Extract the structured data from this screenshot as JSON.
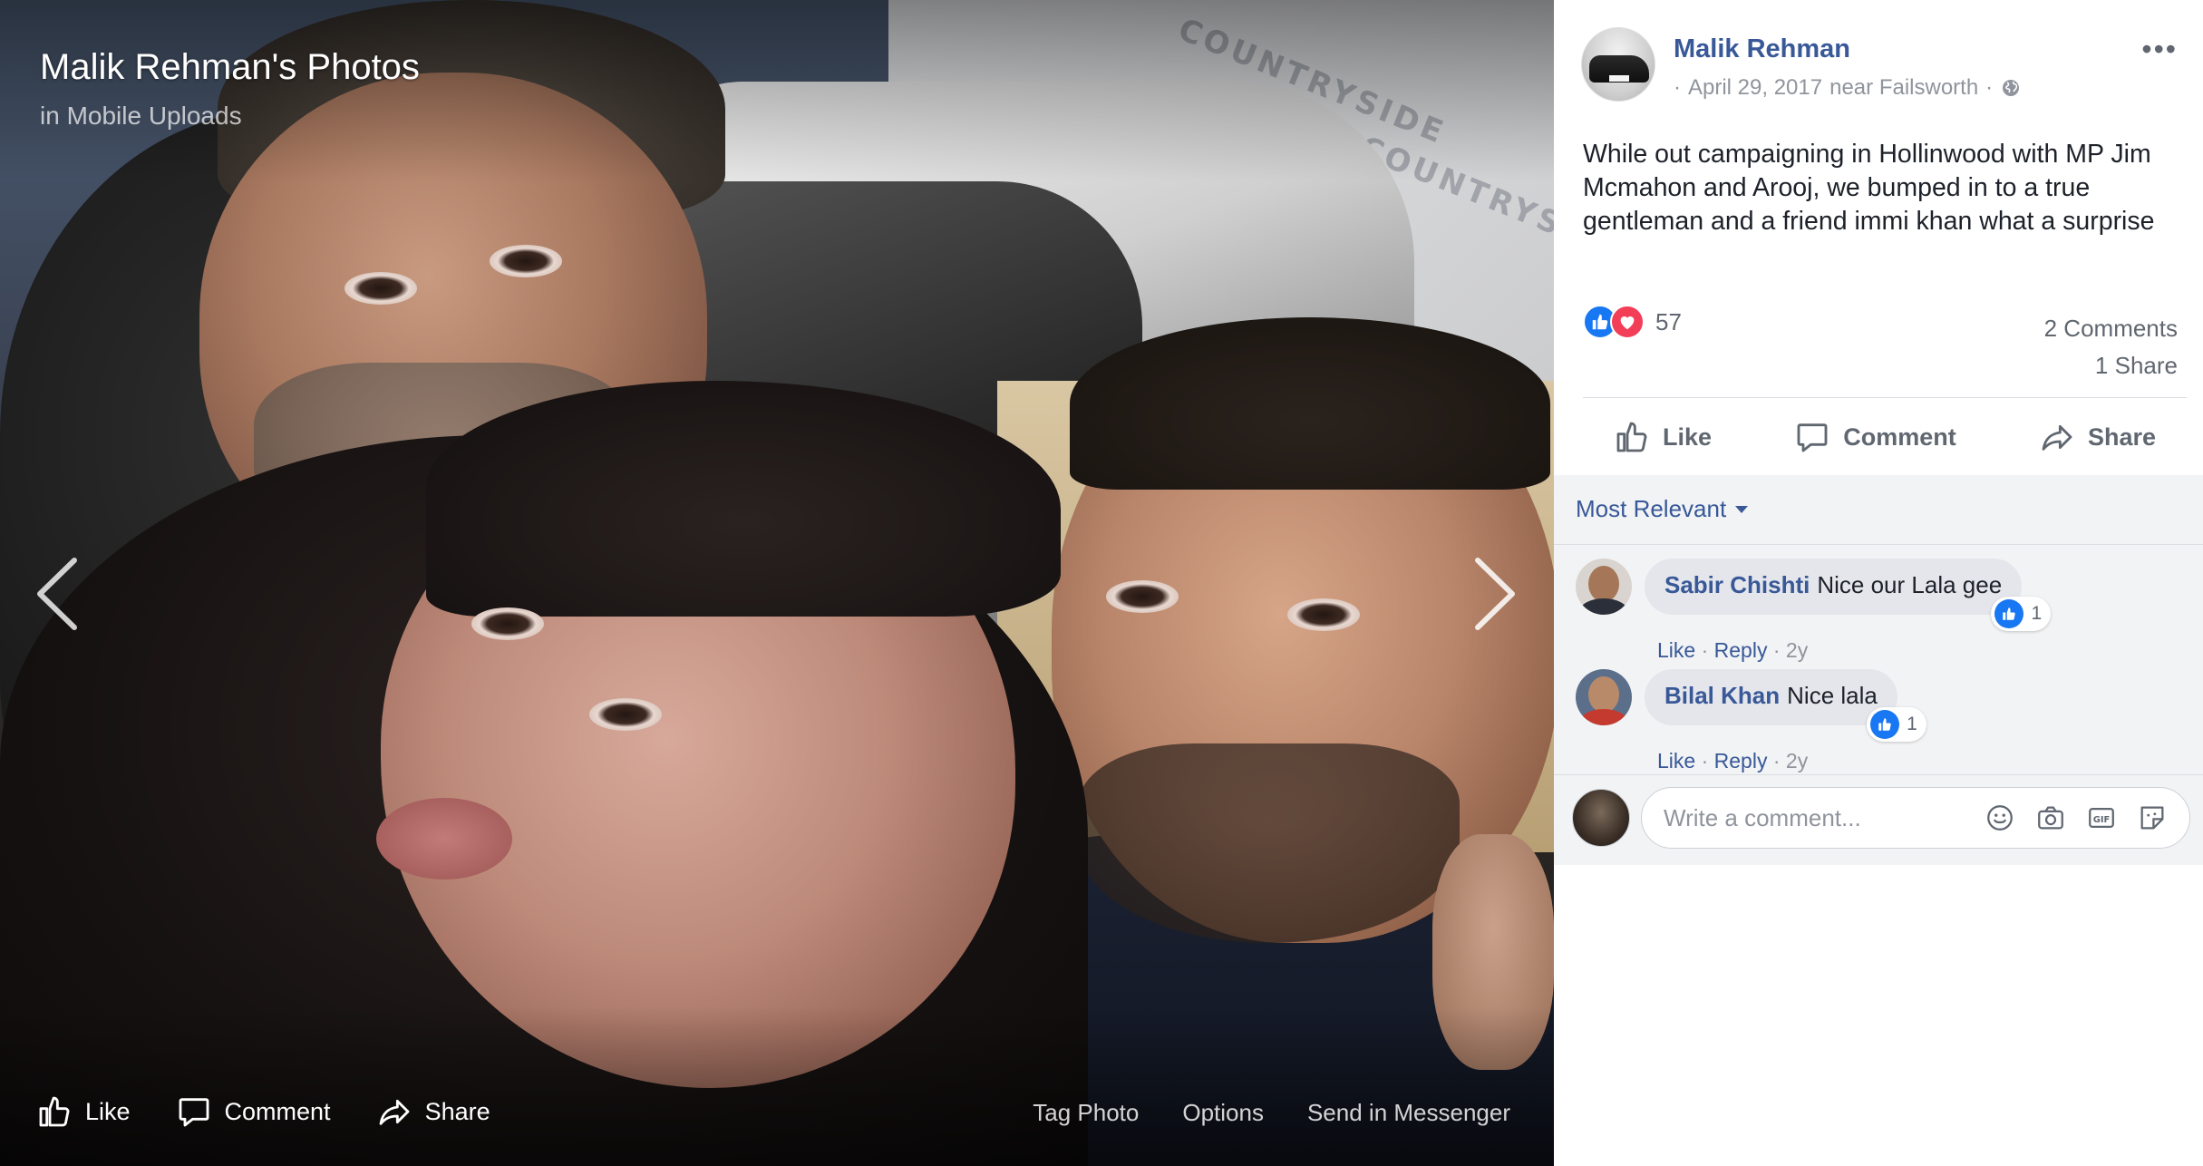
{
  "viewer": {
    "title": "Malik Rehman's Photos",
    "album_prefix": "in",
    "album_name": "Mobile Uploads",
    "wrap_logo_text": "COUNTRYSIDE",
    "actions": {
      "like": "Like",
      "comment": "Comment",
      "share": "Share"
    },
    "links": {
      "tag": "Tag Photo",
      "options": "Options",
      "messenger": "Send in Messenger"
    }
  },
  "post": {
    "author": "Malik Rehman",
    "date": "April 29, 2017",
    "location": "near Failsworth",
    "text": "While out campaigning in Hollinwood with MP Jim Mcmahon and Arooj, we bumped in to a true gentleman and a friend immi khan what a surprise",
    "reaction_count": "57",
    "comments_count": "2 Comments",
    "shares_count": "1 Share",
    "actions": {
      "like": "Like",
      "comment": "Comment",
      "share": "Share"
    }
  },
  "comments": {
    "sort_label": "Most Relevant",
    "items": [
      {
        "author": "Sabir Chishti",
        "text": "Nice our Lala gee",
        "likes": "1",
        "like": "Like",
        "reply": "Reply",
        "age": "2y"
      },
      {
        "author": "Bilal Khan",
        "text": "Nice lala",
        "likes": "1",
        "like": "Like",
        "reply": "Reply",
        "age": "2y"
      }
    ],
    "compose_placeholder": "Write a comment..."
  },
  "colors": {
    "link": "#385898",
    "like": "#1877f2",
    "love": "#f33e58",
    "meta": "#90949c"
  },
  "icons": [
    "thumbs-up-icon",
    "comment-icon",
    "share-icon",
    "chevron-left-icon",
    "chevron-right-icon",
    "globe-icon",
    "more-icon",
    "emoji-icon",
    "camera-icon",
    "gif-icon",
    "sticker-icon",
    "heart-icon"
  ]
}
